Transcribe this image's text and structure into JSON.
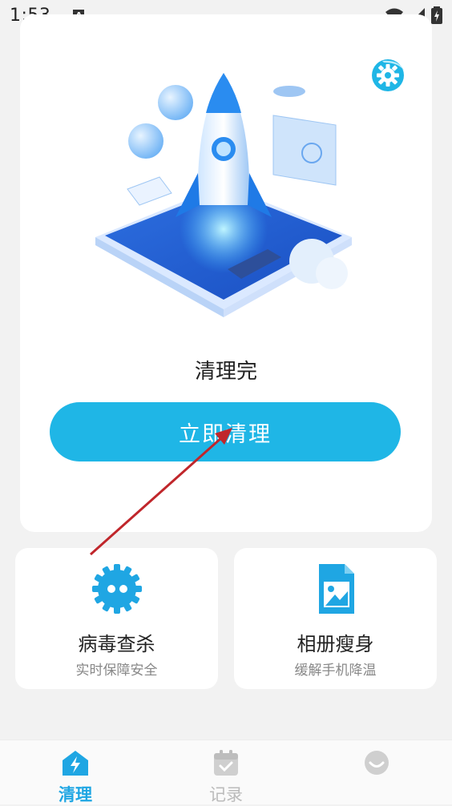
{
  "status_bar": {
    "time": "1:53",
    "badge": "A"
  },
  "main_card": {
    "status_text": "清理完",
    "clean_button_label": "立即清理",
    "hero_icon": "rocket-illustration",
    "settings_icon": "gear-icon"
  },
  "features": [
    {
      "title": "病毒查杀",
      "subtitle": "实时保障安全",
      "icon": "virus-gear-icon"
    },
    {
      "title": "相册瘦身",
      "subtitle": "缓解手机降温",
      "icon": "photo-document-icon"
    }
  ],
  "tabs": [
    {
      "label": "清理",
      "icon": "lightning-home-icon",
      "active": true
    },
    {
      "label": "记录",
      "icon": "calendar-check-icon",
      "active": false
    },
    {
      "label": "",
      "icon": "smile-face-icon",
      "active": false
    }
  ],
  "colors": {
    "accent": "#1fb6e6",
    "tab_active": "#1fa6e3",
    "background": "#f2f2f2",
    "annotation_arrow": "#c0262b"
  }
}
